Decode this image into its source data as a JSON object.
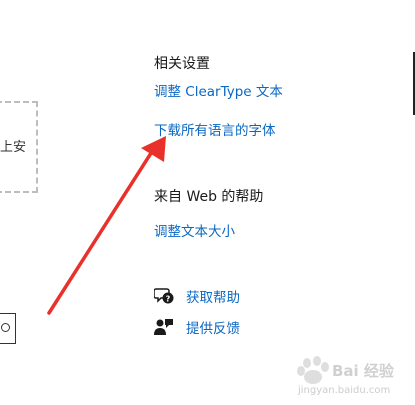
{
  "left_panel": {
    "drop_box_text": "上安"
  },
  "related_settings": {
    "heading": "相关设置",
    "links": [
      "调整 ClearType 文本",
      "下载所有语言的字体"
    ]
  },
  "web_help": {
    "heading": "来自 Web 的帮助",
    "links": [
      "调整文本大小"
    ]
  },
  "support": {
    "get_help": "获取帮助",
    "feedback": "提供反馈"
  },
  "annotation": {
    "arrow_color": "#e8312a"
  },
  "watermark": {
    "brand": "Bai 经验",
    "url": "jingyan.baidu.com"
  }
}
